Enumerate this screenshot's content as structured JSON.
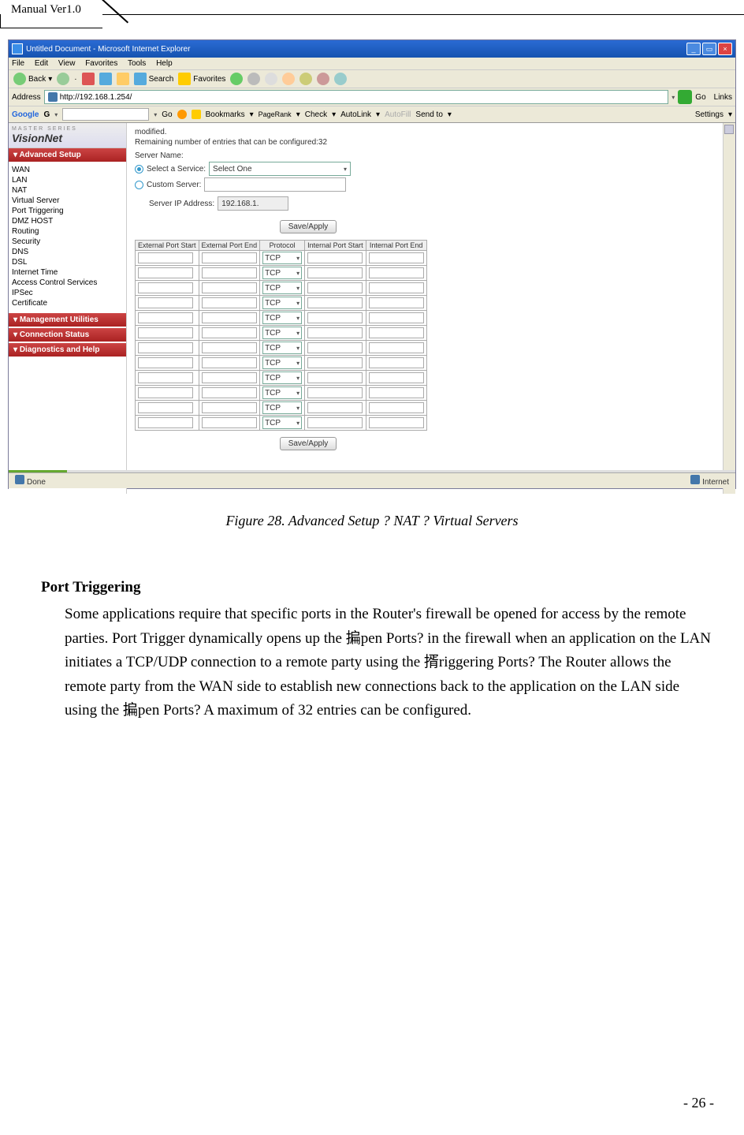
{
  "page_header": "Manual Ver1.0",
  "page_number": "- 26 -",
  "caption": "Figure 28. Advanced Setup ? NAT ? Virtual Servers",
  "body": {
    "heading": "Port Triggering",
    "paragraph": "Some applications require that specific ports in the Router's firewall be opened for access by the remote parties. Port Trigger dynamically opens up the 揙pen Ports? in the firewall when an application on the LAN initiates a TCP/UDP connection to a remote party using the 揟riggering Ports?  The Router allows the remote party from the WAN side to establish new connections back to the application on the LAN side using the 揙pen Ports?  A maximum of 32 entries can be configured."
  },
  "browser": {
    "title": "Untitled Document - Microsoft Internet Explorer",
    "menus": [
      "File",
      "Edit",
      "View",
      "Favorites",
      "Tools",
      "Help"
    ],
    "back": "Back",
    "search": "Search",
    "favorites": "Favorites",
    "address_label": "Address",
    "url": "http://192.168.1.254/",
    "go": "Go",
    "links": "Links",
    "google_label": "Google",
    "google_go": "Go",
    "google_items": [
      "Bookmarks",
      "PageRank",
      "Check",
      "AutoLink",
      "AutoFill",
      "Send to"
    ],
    "settings": "Settings",
    "status_done": "Done",
    "status_zone": "Internet"
  },
  "router": {
    "brand_small": "MASTER SERIES",
    "brand": "VisionNet",
    "sections": {
      "advanced": "Advanced Setup",
      "mgmt": "Management Utilities",
      "conn": "Connection Status",
      "diag": "Diagnostics and Help"
    },
    "adv_items": [
      "WAN",
      "LAN",
      "NAT"
    ],
    "nat_sub": [
      "Virtual Server",
      "Port Triggering",
      "DMZ HOST"
    ],
    "adv_rest": [
      "Routing",
      "Security",
      "DNS",
      "DSL",
      "Internet Time",
      "Access Control Services",
      "IPSec",
      "Certificate"
    ],
    "modified": "modified.",
    "remaining": "Remaining number of entries that can be configured:32",
    "server_name": "Server Name:",
    "select_service": "Select a Service:",
    "select_one": "Select One",
    "custom_server": "Custom Server:",
    "server_ip": "Server IP Address:",
    "ip_value": "192.168.1.",
    "save_apply": "Save/Apply",
    "table": {
      "h1": "External Port Start",
      "h2": "External Port End",
      "h3": "Protocol",
      "h4": "Internal Port Start",
      "h5": "Internal Port End",
      "proto": "TCP",
      "rows": 12
    }
  }
}
